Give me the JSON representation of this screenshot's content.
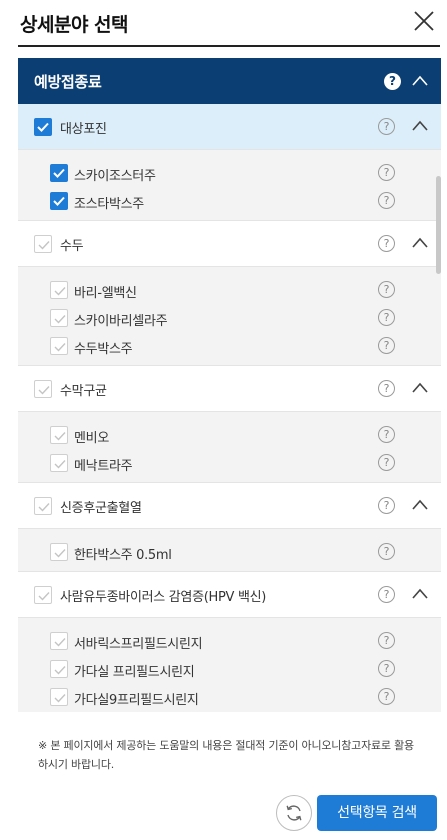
{
  "header": {
    "title": "상세분야 선택",
    "close_icon": "close-icon"
  },
  "category": {
    "title": "예방접종료",
    "help": "?"
  },
  "groups": [
    {
      "label": "대상포진",
      "checked": true,
      "items": [
        {
          "label": "스카이조스터주",
          "checked": true
        },
        {
          "label": "조스타박스주",
          "checked": true
        }
      ]
    },
    {
      "label": "수두",
      "checked": false,
      "items": [
        {
          "label": "바리-엘백신",
          "checked": false
        },
        {
          "label": "스카이바리셀라주",
          "checked": false
        },
        {
          "label": "수두박스주",
          "checked": false
        }
      ]
    },
    {
      "label": "수막구균",
      "checked": false,
      "items": [
        {
          "label": "멘비오",
          "checked": false
        },
        {
          "label": "메낙트라주",
          "checked": false
        }
      ]
    },
    {
      "label": "신증후군출혈열",
      "checked": false,
      "items": [
        {
          "label": "한타박스주 0.5ml",
          "checked": false
        }
      ]
    },
    {
      "label": "사람유두종바이러스 감염증(HPV 백신)",
      "checked": false,
      "items": [
        {
          "label": "서바릭스프리필드시린지",
          "checked": false
        },
        {
          "label": "가다실 프리필드시린지",
          "checked": false
        },
        {
          "label": "가다실9프리필드시린지",
          "checked": false
        }
      ]
    }
  ],
  "help_symbol": "?",
  "notice": "※ 본 페이지에서 제공하는 도움말의 내용은 절대적 기준이 아니오니참고자료로 활용하시기 바랍니다.",
  "footer": {
    "refresh_icon": "refresh-icon",
    "search_label": "선택항목 검색"
  },
  "colors": {
    "header_bg": "#0b3e72",
    "accent": "#1f7cd6",
    "selected_row": "#dceefa"
  }
}
